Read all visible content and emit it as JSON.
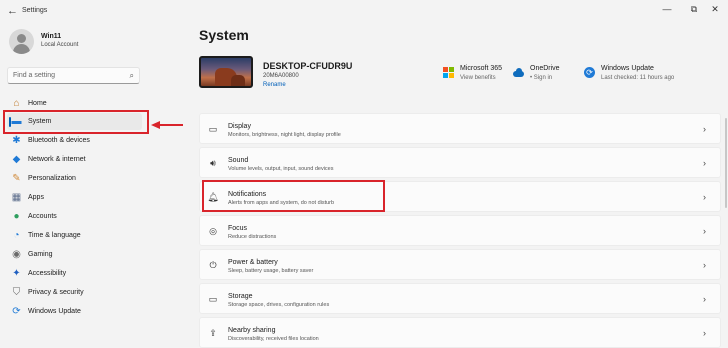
{
  "window": {
    "title": "Settings",
    "back_glyph": "←",
    "minimize_glyph": "—",
    "restore_glyph": "⧉",
    "close_glyph": "✕"
  },
  "user": {
    "name": "Win11",
    "account_type": "Local Account"
  },
  "search": {
    "placeholder": "Find a setting",
    "icon": "search-icon"
  },
  "nav": {
    "items": [
      {
        "label": "Home",
        "icon": "home-icon",
        "glyph": "⌂",
        "color": "#c07a2a"
      },
      {
        "label": "System",
        "icon": "system-icon",
        "glyph": "▬",
        "color": "#1f7ad6"
      },
      {
        "label": "Bluetooth & devices",
        "icon": "bluetooth-icon",
        "glyph": "✱",
        "color": "#1f7ad6"
      },
      {
        "label": "Network & internet",
        "icon": "wifi-icon",
        "glyph": "◆",
        "color": "#1f7ad6"
      },
      {
        "label": "Personalization",
        "icon": "brush-icon",
        "glyph": "✎",
        "color": "#d08a3a"
      },
      {
        "label": "Apps",
        "icon": "apps-icon",
        "glyph": "▦",
        "color": "#5a6b8a"
      },
      {
        "label": "Accounts",
        "icon": "accounts-icon",
        "glyph": "●",
        "color": "#2e9e5e"
      },
      {
        "label": "Time & language",
        "icon": "globe-icon",
        "glyph": "◔",
        "color": "#1f7ad6"
      },
      {
        "label": "Gaming",
        "icon": "gamepad-icon",
        "glyph": "◉",
        "color": "#6b6b6b"
      },
      {
        "label": "Accessibility",
        "icon": "accessibility-icon",
        "glyph": "✦",
        "color": "#1f5fc0"
      },
      {
        "label": "Privacy & security",
        "icon": "shield-icon",
        "glyph": "⛉",
        "color": "#6b6b6b"
      },
      {
        "label": "Windows Update",
        "icon": "update-icon",
        "glyph": "⟳",
        "color": "#1f7ad6"
      }
    ]
  },
  "main": {
    "title": "System",
    "device": {
      "name": "DESKTOP-CFUDR9U",
      "model": "20M6A00800",
      "rename": "Rename"
    },
    "services": [
      {
        "title": "Microsoft 365",
        "subtitle": "View benefits",
        "icon": "microsoft-365-icon"
      },
      {
        "title": "OneDrive",
        "subtitle": "• Sign in",
        "icon": "onedrive-icon"
      },
      {
        "title": "Windows Update",
        "subtitle": "Last checked: 11 hours ago",
        "icon": "windows-update-icon"
      }
    ],
    "cards": [
      {
        "title": "Display",
        "subtitle": "Monitors, brightness, night light, display profile",
        "icon": "display-icon",
        "glyph": "▭"
      },
      {
        "title": "Sound",
        "subtitle": "Volume levels, output, input, sound devices",
        "icon": "sound-icon",
        "glyph": "🔊︎"
      },
      {
        "title": "Notifications",
        "subtitle": "Alerts from apps and system, do not disturb",
        "icon": "bell-icon",
        "glyph": "🔔︎"
      },
      {
        "title": "Focus",
        "subtitle": "Reduce distractions",
        "icon": "focus-icon",
        "glyph": "◎"
      },
      {
        "title": "Power & battery",
        "subtitle": "Sleep, battery usage, battery saver",
        "icon": "power-icon",
        "glyph": "⏻"
      },
      {
        "title": "Storage",
        "subtitle": "Storage space, drives, configuration rules",
        "icon": "storage-icon",
        "glyph": "▭"
      },
      {
        "title": "Nearby sharing",
        "subtitle": "Discoverability, received files location",
        "icon": "share-icon",
        "glyph": "⇪"
      }
    ],
    "chevron": "›"
  },
  "colors": {
    "accent": "#005fb8",
    "highlight": "#d9242b"
  }
}
